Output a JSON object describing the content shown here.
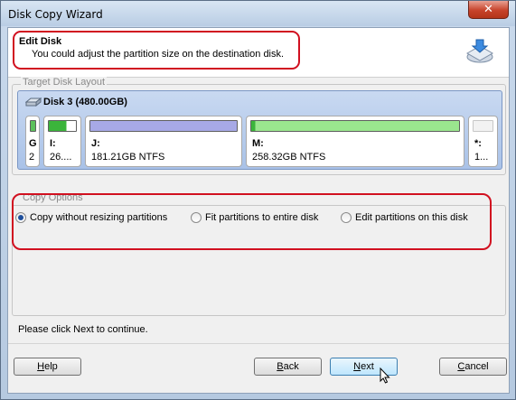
{
  "window": {
    "title": "Disk Copy Wizard",
    "close_label": "✕"
  },
  "header": {
    "title": "Edit Disk",
    "subtitle": "You could adjust the partition size on the destination disk."
  },
  "layout_group": {
    "label": "Target Disk Layout",
    "disk_name": "Disk 3 (480.00GB)",
    "partitions": [
      {
        "label": "G",
        "size": "2",
        "bar_color": "#5cc05c"
      },
      {
        "label": "I:",
        "size": "26....",
        "bar_color": "#3bb43b"
      },
      {
        "label": "J:",
        "size": "181.21GB NTFS",
        "bar_color": "#a7a9e6"
      },
      {
        "label": "M:",
        "size": "258.32GB NTFS",
        "bar_color": "#9ae68e"
      },
      {
        "label": "*:",
        "size": "1...",
        "bar_color": "#f2f2f2"
      }
    ]
  },
  "options_group": {
    "label": "Copy Options",
    "options": [
      {
        "label": "Copy without resizing partitions",
        "selected": true
      },
      {
        "label": "Fit partitions to entire disk",
        "selected": false
      },
      {
        "label": "Edit partitions on this disk",
        "selected": false
      }
    ]
  },
  "status": "Please click Next to continue.",
  "buttons": {
    "help_pre": "",
    "help_u": "H",
    "help_post": "elp",
    "back_pre": "",
    "back_u": "B",
    "back_post": "ack",
    "next_pre": "",
    "next_u": "N",
    "next_post": "ext",
    "cancel_pre": "",
    "cancel_u": "C",
    "cancel_post": "ancel"
  },
  "colors": {
    "highlight": "#d11020",
    "selected_radio": "#1f4f9c",
    "disk_panel": "#b9cdee"
  }
}
